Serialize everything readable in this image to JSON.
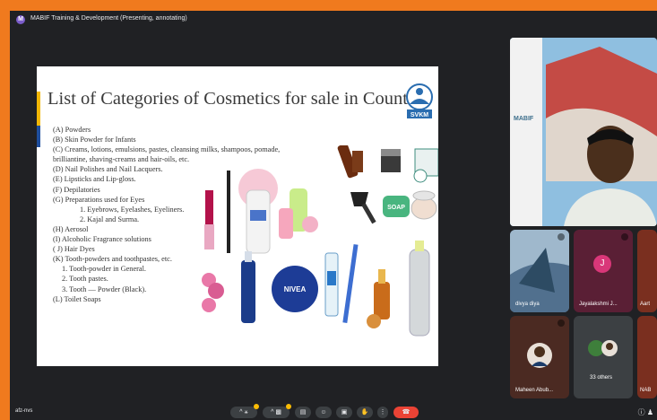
{
  "window": {
    "title": "MABIF Training & Development (Presenting, annotating)",
    "badge_letter": "M"
  },
  "slide": {
    "title": "List of Categories of Cosmetics for sale in Country:",
    "logo_text": "SVKM",
    "items": [
      "(A) Powders",
      "(B) Skin Powder for Infants",
      "(C) Creams, lotions, emulsions, pastes, cleansing milks, shampoos, pomade,",
      "brilliantine, shaving-creams and hair-oils, etc.",
      "(D) Nail Polishes and Nail Lacquers.",
      "(E) Lipsticks and Lip-gloss.",
      "(F) Depilatories",
      "(G) Preparations used for Eyes",
      "1. Eyebrows, Eyelashes, Eyeliners.",
      "2. Kajal and Surma.",
      "(H) Aerosol",
      "(I) Alcoholic Fragrance solutions",
      "( J) Hair Dyes",
      "(K) Tooth-powders and toothpastes, etc.",
      "1. Tooth-powder in General.",
      "2. Tooth pastes.",
      "3. Tooth — Powder (Black).",
      "(L) Toilet Soaps"
    ],
    "product_labels": {
      "soap": "SOAP",
      "nivea": "NIVEA"
    }
  },
  "participants": [
    {
      "name": "divya diya"
    },
    {
      "name": "Jayalakshmi J...",
      "initial": "J"
    },
    {
      "name": "Aart"
    },
    {
      "name": "Maheen Abub..."
    },
    {
      "name": "33 others"
    },
    {
      "name": "NAB"
    }
  ],
  "presenter": {
    "logo_text": "MABIF"
  },
  "bottom": {
    "meeting_code": "afz-nvs"
  },
  "colors": {
    "orange_border": "#f07a1e",
    "meet_dark": "#202124",
    "end_call_red": "#ea4335"
  }
}
